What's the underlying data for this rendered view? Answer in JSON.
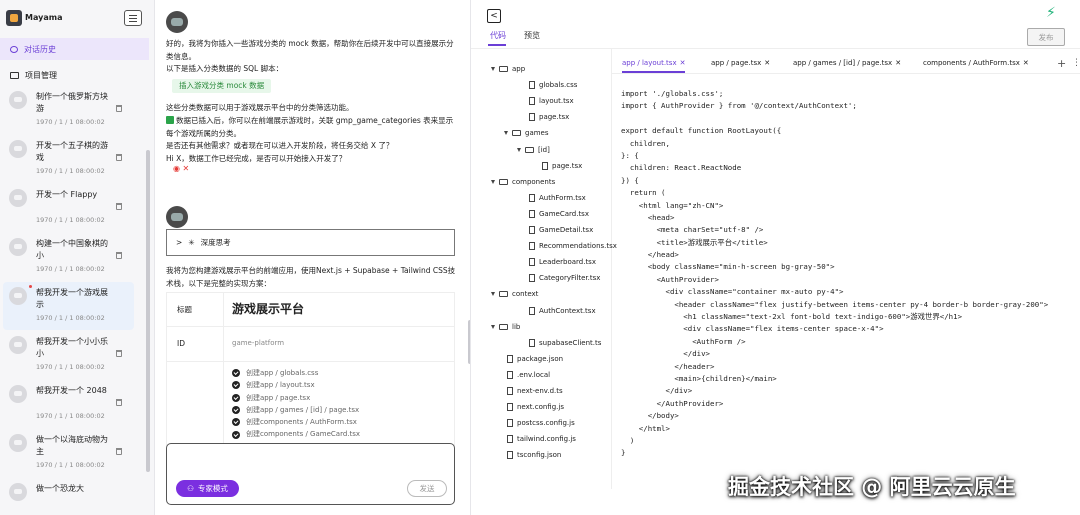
{
  "sidebar": {
    "app_name": "Mayama",
    "nav_history": "对话历史",
    "nav_projects": "项目管理",
    "items": [
      {
        "title": "制作一个俄罗斯方块游",
        "time": "1970 / 1 / 1 08:00:02",
        "active": false
      },
      {
        "title": "开发一个五子棋的游戏",
        "time": "1970 / 1 / 1 08:00:02",
        "active": false
      },
      {
        "title": "开发一个 Flappy",
        "time": "1970 / 1 / 1 08:00:02",
        "active": false
      },
      {
        "title": "构建一个中国象棋的小",
        "time": "1970 / 1 / 1 08:00:02",
        "active": false
      },
      {
        "title": "帮我开发一个游戏展示",
        "time": "1970 / 1 / 1 08:00:02",
        "active": true
      },
      {
        "title": "帮我开发一个小小乐小",
        "time": "1970 / 1 / 1 08:00:02",
        "active": false
      },
      {
        "title": "帮我开发一个 2048",
        "time": "1970 / 1 / 1 08:00:02",
        "active": false
      },
      {
        "title": "做一个以海底动物为主",
        "time": "1970 / 1 / 1 08:00:02",
        "active": false
      },
      {
        "title": "做一个恐龙大",
        "time": "",
        "active": false
      }
    ]
  },
  "chat": {
    "msg1_line1": "好的，我将为你插入一些游戏分类的 mock 数据，帮助你在后续开发中可以直接展示分类信息。",
    "msg1_line2": "以下是插入分类数据的 SQL 脚本：",
    "insert_button": "插入游戏分类 mock 数据",
    "msg1_line3": "这些分类数据可以用于游戏展示平台中的分类筛选功能。",
    "msg1_line4": "数据已插入后，你可以在前端展示游戏时，关联 gmp_game_categories 表来显示每个游戏所属的分类。",
    "msg1_line5": "是否还有其他需求？或者现在可以进入开发阶段，将任务交给 X 了？",
    "msg1_line6": "Hi X，数据工作已经完成，是否可以开始接入开发了？",
    "err_marks": "◉ ✕",
    "think_label": "深度思考",
    "intro": "我将为您构建游戏展示平台的前端应用，使用Next.js + Supabase + Tailwind CSS技术栈，以下是完整的实现方案：",
    "plan": {
      "title_key": "标题",
      "title_value": "游戏展示平台",
      "id_key": "ID",
      "id_value": "game-platform",
      "steps": [
        "创建app / globals.css",
        "创建app / layout.tsx",
        "创建app / page.tsx",
        "创建app / games / [id] / page.tsx",
        "创建components / AuthForm.tsx",
        "创建components / GameCard.tsx"
      ]
    },
    "composer": {
      "expert_label": "专家模式",
      "send_label": "发送"
    }
  },
  "panel": {
    "tab_code": "代码",
    "tab_preview": "预览",
    "deploy_label": "发布",
    "tree": [
      {
        "label": "app",
        "type": "folder",
        "depth": 0
      },
      {
        "label": "globals.css",
        "type": "file",
        "depth": 2
      },
      {
        "label": "layout.tsx",
        "type": "file",
        "depth": 2
      },
      {
        "label": "page.tsx",
        "type": "file",
        "depth": 2
      },
      {
        "label": "games",
        "type": "folder",
        "depth": 1
      },
      {
        "label": "[id]",
        "type": "folder",
        "depth": 2
      },
      {
        "label": "page.tsx",
        "type": "file",
        "depth": 3
      },
      {
        "label": "components",
        "type": "folder",
        "depth": 0
      },
      {
        "label": "AuthForm.tsx",
        "type": "file",
        "depth": 2
      },
      {
        "label": "GameCard.tsx",
        "type": "file",
        "depth": 2
      },
      {
        "label": "GameDetail.tsx",
        "type": "file",
        "depth": 2
      },
      {
        "label": "Recommendations.tsx",
        "type": "file",
        "depth": 2
      },
      {
        "label": "Leaderboard.tsx",
        "type": "file",
        "depth": 2
      },
      {
        "label": "CategoryFilter.tsx",
        "type": "file",
        "depth": 2
      },
      {
        "label": "context",
        "type": "folder",
        "depth": 0
      },
      {
        "label": "AuthContext.tsx",
        "type": "file",
        "depth": 2
      },
      {
        "label": "lib",
        "type": "folder",
        "depth": 0
      },
      {
        "label": "supabaseClient.ts",
        "type": "file",
        "depth": 2
      },
      {
        "label": "package.json",
        "type": "file",
        "depth": 0
      },
      {
        "label": ".env.local",
        "type": "file",
        "depth": 0
      },
      {
        "label": "next-env.d.ts",
        "type": "file",
        "depth": 0
      },
      {
        "label": "next.config.js",
        "type": "file",
        "depth": 0
      },
      {
        "label": "postcss.config.js",
        "type": "file",
        "depth": 0
      },
      {
        "label": "tailwind.config.js",
        "type": "file",
        "depth": 0
      },
      {
        "label": "tsconfig.json",
        "type": "file",
        "depth": 0
      }
    ],
    "editor_tabs": [
      {
        "label": "app / layout.tsx",
        "active": true
      },
      {
        "label": "app / page.tsx",
        "active": false
      },
      {
        "label": "app / games / [id] / page.tsx",
        "active": false
      },
      {
        "label": "components / AuthForm.tsx",
        "active": false
      }
    ],
    "code_lines": [
      "import './globals.css';",
      "import { AuthProvider } from '@/context/AuthContext';",
      "",
      "export default function RootLayout({",
      "  children,",
      "}: {",
      "  children: React.ReactNode",
      "}) {",
      "  return (",
      "    <html lang=\"zh-CN\">",
      "      <head>",
      "        <meta charSet=\"utf-8\" />",
      "        <title>游戏展示平台</title>",
      "      </head>",
      "      <body className=\"min-h-screen bg-gray-50\">",
      "        <AuthProvider>",
      "          <div className=\"container mx-auto py-4\">",
      "            <header className=\"flex justify-between items-center py-4 border-b border-gray-200\">",
      "              <h1 className=\"text-2xl font-bold text-indigo-600\">游戏世界</h1>",
      "              <div className=\"flex items-center space-x-4\">",
      "                <AuthForm />",
      "              </div>",
      "            </header>",
      "            <main>{children}</main>",
      "          </div>",
      "        </AuthProvider>",
      "      </body>",
      "    </html>",
      "  )",
      "}"
    ]
  },
  "watermark": "掘金技术社区 @ 阿里云云原生"
}
